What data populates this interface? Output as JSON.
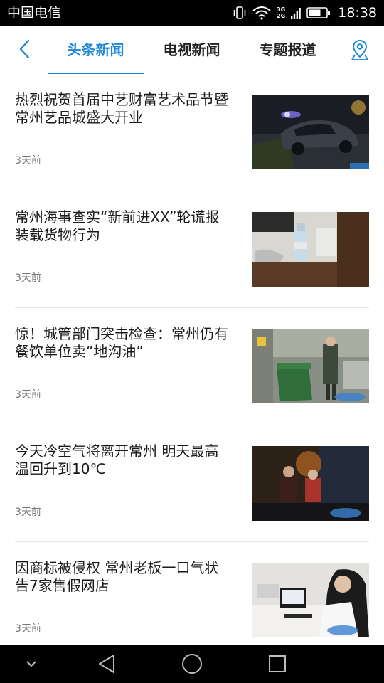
{
  "status_bar": {
    "carrier": "中国电信",
    "network_top": "3G",
    "network_bottom": "2G",
    "time": "18:38"
  },
  "nav": {
    "tabs": [
      {
        "label": "头条新闻",
        "active": true
      },
      {
        "label": "电视新闻",
        "active": false
      },
      {
        "label": "专题报道",
        "active": false
      }
    ]
  },
  "news": [
    {
      "title": "热烈祝贺首届中艺财富艺术品节暨常州艺品城盛大开业",
      "time": "3天前",
      "thumb": "burned-car-night-photo"
    },
    {
      "title": "常州海事查实“新前进XX”轮谎报装载货物行为",
      "time": "3天前",
      "thumb": "desk-water-bottle-photo"
    },
    {
      "title": "惊！城管部门突击检查：常州仍有餐饮单位卖“地沟油”",
      "time": "3天前",
      "thumb": "kitchen-inspection-photo"
    },
    {
      "title": "今天冷空气将离开常州 明天最高温回升到10℃",
      "time": "3天前",
      "thumb": "cold-night-street-photo"
    },
    {
      "title": "因商标被侵权 常州老板一口气状告7家售假网店",
      "time": "3天前",
      "thumb": "office-computer-photo"
    }
  ],
  "colors": {
    "accent": "#1e88d8",
    "title_text": "#1a1a1a",
    "meta_text": "#777777"
  }
}
